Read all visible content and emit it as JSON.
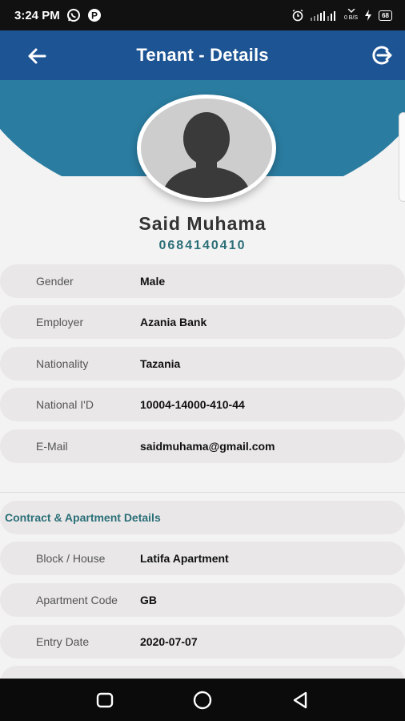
{
  "status_bar": {
    "time": "3:24 PM",
    "left_icons": [
      "whatsapp-icon",
      "p-app-icon"
    ],
    "right_icons": [
      "alarm-icon",
      "signal-icon",
      "data-speed-icon",
      "charging-icon",
      "battery-icon"
    ],
    "data_speed": "0 B/S",
    "battery_level": "68"
  },
  "app_bar": {
    "title": "Tenant - Details",
    "back_icon": "arrow-left-icon",
    "logout_icon": "logout-icon",
    "color": "#1d5493"
  },
  "profile": {
    "name": "Said Muhama",
    "phone": "0684140410",
    "avatar_icon": "person-silhouette-icon",
    "accent": "#2a7ca0"
  },
  "personal_details": [
    {
      "label": "Gender",
      "value": "Male"
    },
    {
      "label": "Employer",
      "value": "Azania Bank"
    },
    {
      "label": "Nationality",
      "value": "Tazania"
    },
    {
      "label": "National I'D",
      "value": "10004-14000-410-44"
    },
    {
      "label": "E-Mail",
      "value": "saidmuhama@gmail.com"
    }
  ],
  "contract_section": {
    "title": "Contract & Apartment Details",
    "items": [
      {
        "label": "Block / House",
        "value": "Latifa Apartment"
      },
      {
        "label": "Apartment Code",
        "value": "GB"
      },
      {
        "label": "Entry Date",
        "value": "2020-07-07"
      }
    ]
  },
  "nav_bar": {
    "buttons": [
      "recent-apps-icon",
      "home-icon",
      "back-triangle-icon"
    ]
  }
}
